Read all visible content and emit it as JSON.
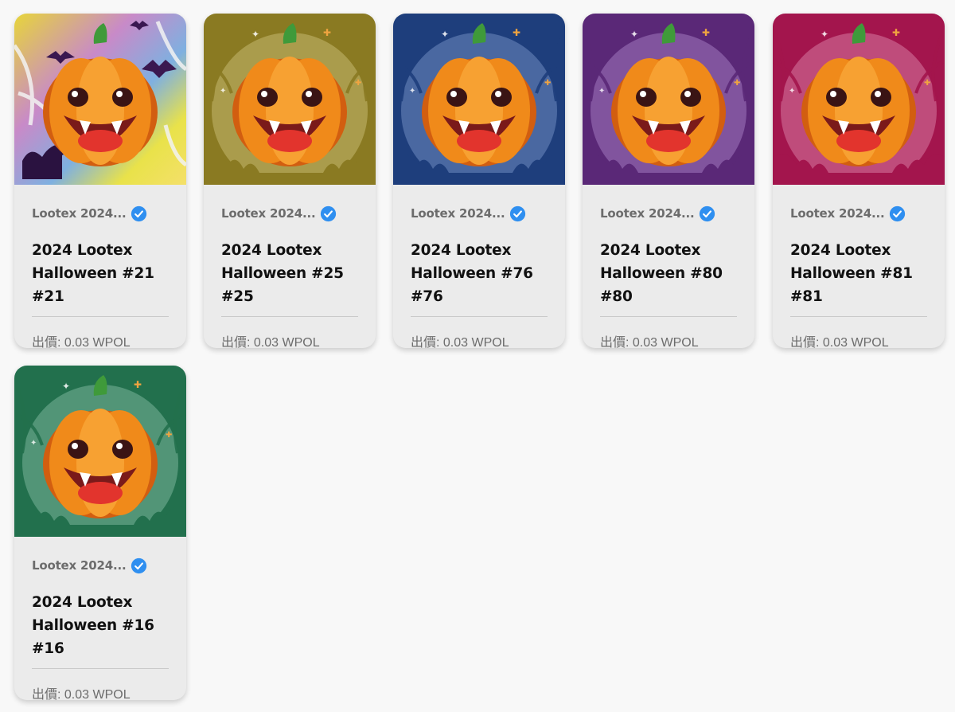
{
  "cards": [
    {
      "collection": "Lootex 2024...",
      "name_line1": "2024 Lootex",
      "name_line2": "Halloween #21",
      "name_line3": "#21",
      "offer_label": "出價: 0.03 WPOL",
      "theme": "rainbow",
      "bg": "#e9d94a",
      "accent": "#a97fc8"
    },
    {
      "collection": "Lootex 2024...",
      "name_line1": "2024 Lootex",
      "name_line2": "Halloween #25",
      "name_line3": "#25",
      "offer_label": "出價: 0.03 WPOL",
      "theme": "olive",
      "bg": "#8a7a22",
      "accent": "#c5b870"
    },
    {
      "collection": "Lootex 2024...",
      "name_line1": "2024 Lootex",
      "name_line2": "Halloween #76",
      "name_line3": "#76",
      "offer_label": "出價: 0.03 WPOL",
      "theme": "blue",
      "bg": "#1e3e7c",
      "accent": "#6f8bc0"
    },
    {
      "collection": "Lootex 2024...",
      "name_line1": "2024 Lootex",
      "name_line2": "Halloween #80",
      "name_line3": "#80",
      "offer_label": "出價: 0.03 WPOL",
      "theme": "purple",
      "bg": "#5a2877",
      "accent": "#a279bf"
    },
    {
      "collection": "Lootex 2024...",
      "name_line1": "2024 Lootex",
      "name_line2": "Halloween #81",
      "name_line3": "#81",
      "offer_label": "出價: 0.03 WPOL",
      "theme": "magenta",
      "bg": "#a3154d",
      "accent": "#d77aa3"
    },
    {
      "collection": "Lootex 2024...",
      "name_line1": "2024 Lootex",
      "name_line2": "Halloween #16",
      "name_line3": "#16",
      "offer_label": "出價: 0.03 WPOL",
      "theme": "green",
      "bg": "#22704d",
      "accent": "#7ab49a"
    }
  ],
  "colors": {
    "verified_badge": "#2f8ff0",
    "pumpkin": "#f08a1a",
    "pumpkin_dark": "#d25e10",
    "stem": "#3f9a3a",
    "mouth": "#7a1a1a",
    "tongue": "#e2342d"
  },
  "icons": {
    "verified": "verified-check-icon",
    "artwork": "pumpkin-artwork"
  }
}
